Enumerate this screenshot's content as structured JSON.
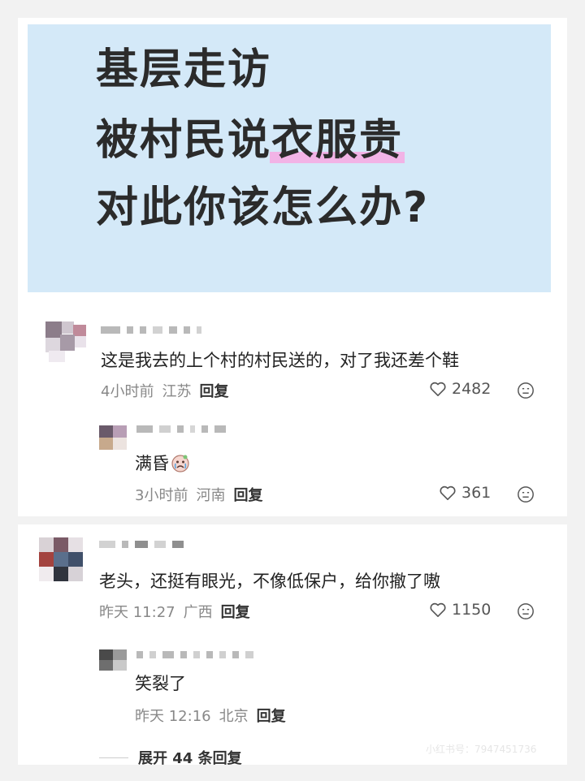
{
  "banner": {
    "line1": "基层走访",
    "line2_plain": "被村民说",
    "line2_highlight": "衣服贵",
    "line3": "对此你该怎么办?"
  },
  "comments": [
    {
      "text": "这是我去的上个村的村民送的，对了我还差个鞋",
      "time": "4小时前",
      "location": "江苏",
      "reply_label": "回复",
      "likes": "2482",
      "replies": [
        {
          "text": "满昏",
          "sticker": "crying-face-sticker",
          "time": "3小时前",
          "location": "河南",
          "reply_label": "回复",
          "likes": "361"
        }
      ]
    },
    {
      "text": "老头，还挺有眼光，不像低保户，给你撤了嗷",
      "time": "昨天 11:27",
      "location": "广西",
      "reply_label": "回复",
      "likes": "1150",
      "replies": [
        {
          "text": "笑裂了",
          "time": "昨天 12:16",
          "location": "北京",
          "reply_label": "回复"
        }
      ],
      "expand_label": "展开 44 条回复"
    }
  ],
  "watermark": "小红书号：7947451736",
  "icons": {
    "like": "heart-outline-icon",
    "dislike": "dislike-face-icon"
  },
  "colors": {
    "banner_bg": "#d4e9f8",
    "highlight": "#f2b3e6",
    "text": "#222222",
    "meta": "#888888"
  }
}
